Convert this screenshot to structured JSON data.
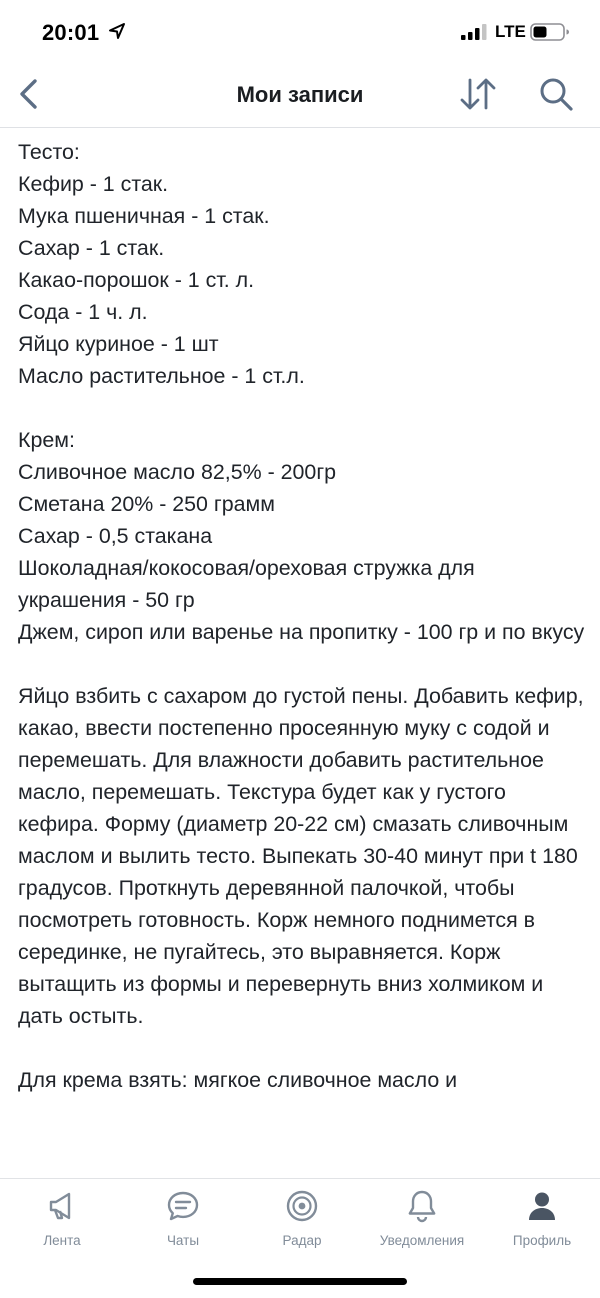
{
  "status_bar": {
    "time": "20:01",
    "network": "LTE"
  },
  "nav": {
    "title": "Мои записи",
    "icons": [
      "back-chevron",
      "sort-arrows",
      "search"
    ]
  },
  "note": {
    "text": "Тесто:\nКефир - 1 стак.\nМука пшеничная - 1 стак.\nСахар - 1 стак.\nКакао-порошок - 1 ст. л.\nСода - 1 ч. л.\nЯйцо куриное - 1 шт\nМасло растительное - 1 ст.л.\n\nКрем:\nСливочное масло 82,5% - 200гр\nСметана 20% - 250 грамм\nСахар - 0,5 стакана\nШоколадная/кокосовая/ореховая стружка для украшения - 50 гр\nДжем, сироп или варенье на пропитку - 100 гр и по вкусу\n\nЯйцо взбить с сахаром до густой пены. Добавить кефир, какао, ввести постепенно просеянную муку с содой и перемешать. Для влажности добавить растительное масло, перемешать. Текстура будет как у густого кефира. Форму (диаметр 20-22 см) смазать сливочным маслом и вылить тесто. Выпекать 30-40 минут при t 180 градусов. Проткнуть деревянной палочкой, чтобы посмотреть готовность. Корж немного поднимется в серединке, не пугайтесь, это выравняется. Корж вытащить из формы и перевернуть вниз холмиком и дать остыть.\n\nДля крема взять: мягкое сливочное масло и"
  },
  "tabs": [
    {
      "label": "Лента",
      "icon": "megaphone-icon"
    },
    {
      "label": "Чаты",
      "icon": "chat-bubble-icon"
    },
    {
      "label": "Радар",
      "icon": "radar-icon"
    },
    {
      "label": "Уведомления",
      "icon": "bell-icon"
    },
    {
      "label": "Профиль",
      "icon": "person-icon",
      "active": true
    }
  ],
  "colors": {
    "icon_gray": "#818c99",
    "active_icon": "#4a5563",
    "divider": "#dfe1e5"
  }
}
